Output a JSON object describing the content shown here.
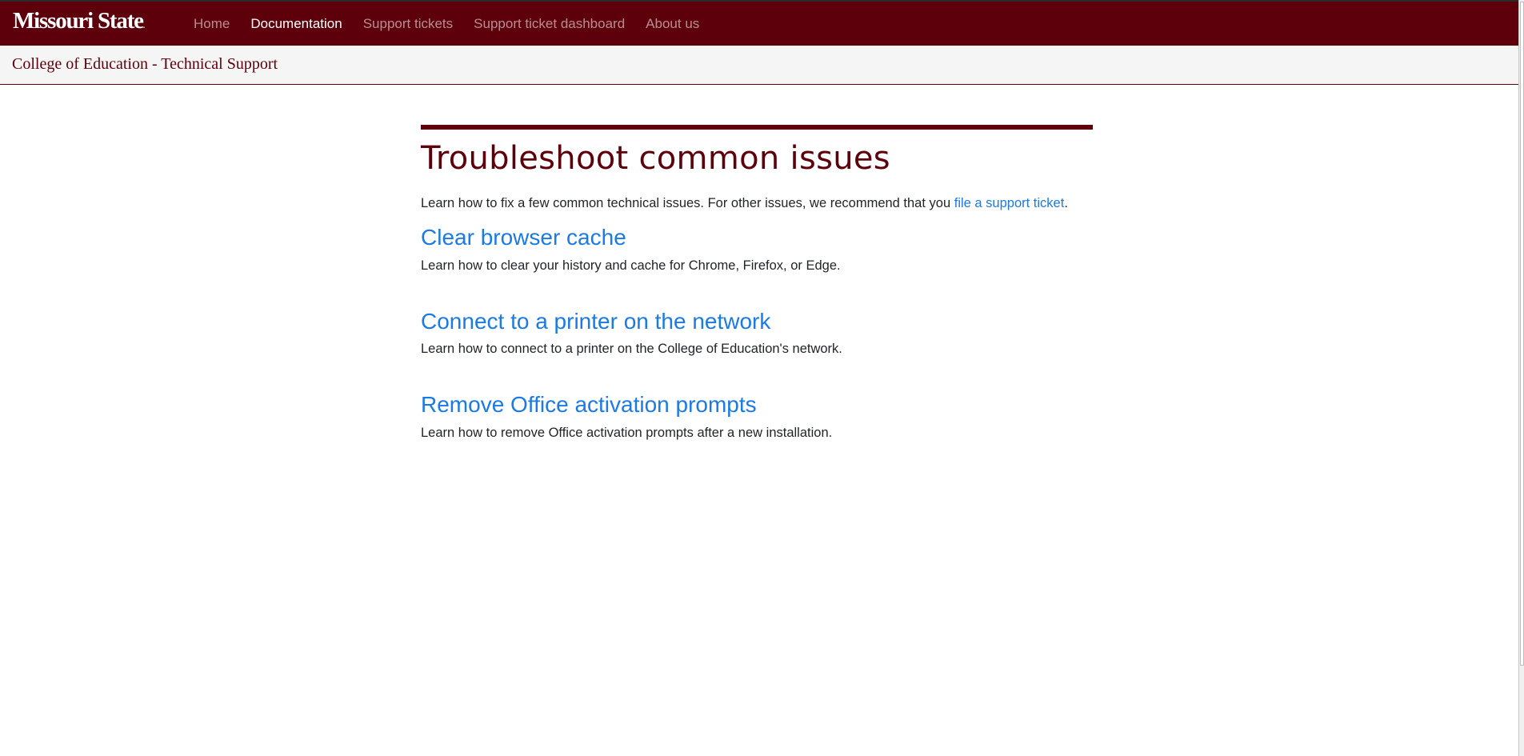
{
  "brand": {
    "name": "Missouri State",
    "trademark": "."
  },
  "nav": {
    "items": [
      {
        "label": "Home"
      },
      {
        "label": "Documentation"
      },
      {
        "label": "Support tickets"
      },
      {
        "label": "Support ticket dashboard"
      },
      {
        "label": "About us"
      }
    ],
    "active": "Documentation"
  },
  "subheader": {
    "title": "College of Education - Technical Support"
  },
  "main": {
    "title": "Troubleshoot common issues",
    "intro_text": "Learn how to fix a few common technical issues. For other issues, we recommend that you ",
    "intro_link": "file a support ticket",
    "intro_end": ".",
    "articles": [
      {
        "title": "Clear browser cache",
        "description": "Learn how to clear your history and cache for Chrome, Firefox, or Edge."
      },
      {
        "title": "Connect to a printer on the network",
        "description": "Learn how to connect to a printer on the College of Education's network."
      },
      {
        "title": "Remove Office activation prompts",
        "description": "Learn how to remove Office activation prompts after a new installation."
      }
    ]
  },
  "colors": {
    "brand_maroon": "#5e000b",
    "link_blue": "#1a7ae6",
    "text": "#212529",
    "subheader_bg": "#f5f5f5"
  }
}
